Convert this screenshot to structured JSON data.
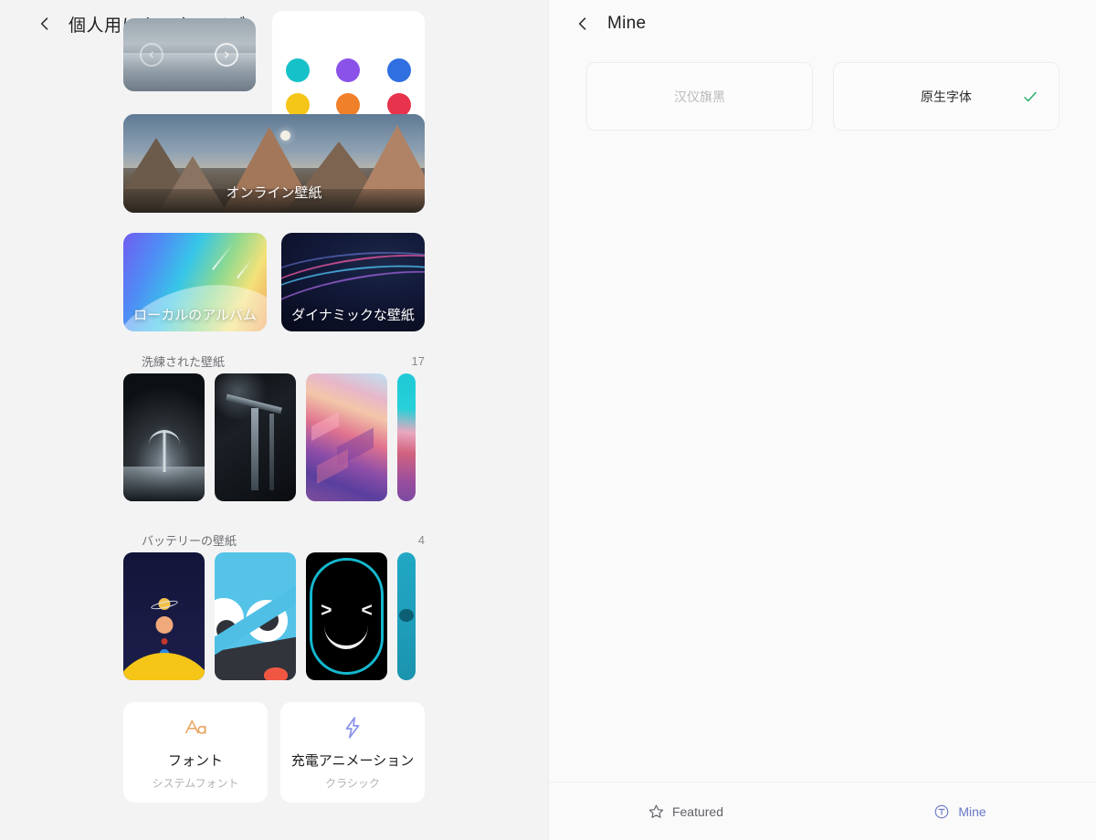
{
  "left": {
    "header": {
      "back_icon": "chevron-left-icon",
      "title": "個人用にカスタマイズ"
    },
    "carousel": {
      "prev_icon": "chevron-left-circle-icon",
      "next_icon": "chevron-right-circle-icon"
    },
    "swatches": [
      {
        "name": "cyan",
        "color": "#17c1c9"
      },
      {
        "name": "purple",
        "color": "#8a52e8"
      },
      {
        "name": "blue",
        "color": "#2f6fe0"
      },
      {
        "name": "yellow",
        "color": "#f5c518"
      },
      {
        "name": "orange",
        "color": "#f0802a"
      },
      {
        "name": "red",
        "color": "#e8334c"
      }
    ],
    "banner": {
      "label": "オンライン壁紙"
    },
    "tiles": [
      {
        "label": "ローカルのアルバム"
      },
      {
        "label": "ダイナミックな壁紙"
      }
    ],
    "sections": [
      {
        "title": "洗練された壁紙",
        "count": "17"
      },
      {
        "title": "バッテリーの壁紙",
        "count": "4"
      }
    ],
    "action_cards": [
      {
        "icon": "font-aa-icon",
        "title": "フォント",
        "subtitle": "システムフォント",
        "accent": "#e8a05a"
      },
      {
        "icon": "lightning-icon",
        "title": "充電アニメーション",
        "subtitle": "クラシック",
        "accent": "#8b93e8"
      }
    ]
  },
  "right": {
    "header": {
      "back_icon": "chevron-left-icon",
      "title": "Mine"
    },
    "fonts": [
      {
        "name": "汉仪旗黑",
        "selected": false
      },
      {
        "name": "原生字体",
        "selected": true,
        "check_icon": "check-icon",
        "check_color": "#27ae68"
      }
    ],
    "bottom_nav": [
      {
        "icon": "star-outline-icon",
        "label": "Featured",
        "active": false,
        "color": "#5f6166"
      },
      {
        "icon": "circled-t-icon",
        "label": "Mine",
        "active": true,
        "color": "#6a77c6"
      }
    ]
  }
}
